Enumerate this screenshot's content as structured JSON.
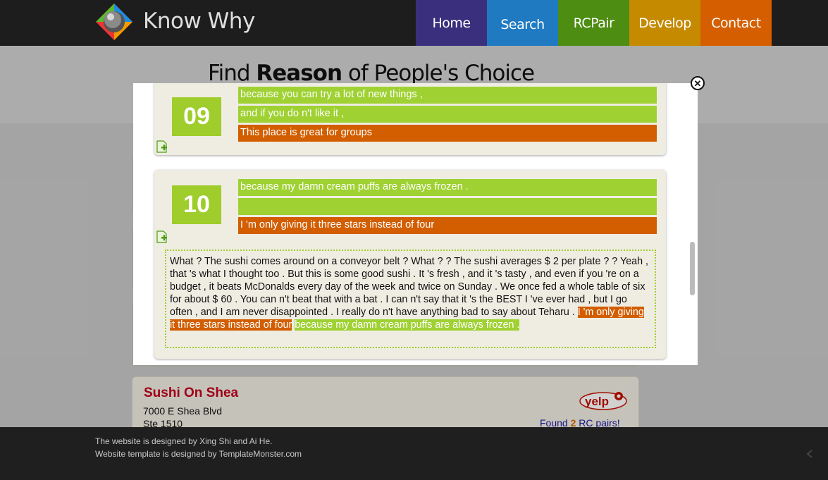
{
  "header": {
    "logo_text": "Know Why",
    "nav": [
      {
        "label": "Home",
        "color": "#3a2f7d"
      },
      {
        "label": "Search",
        "color": "#1f7ac2"
      },
      {
        "label": "RCPair",
        "color": "#4d8d12"
      },
      {
        "label": "Develop",
        "color": "#c58a00"
      },
      {
        "label": "Contact",
        "color": "#d55f00"
      }
    ],
    "active_nav": "Search"
  },
  "tagline": {
    "pre": "Find ",
    "bold": "Reason",
    "post": " of People's Choice"
  },
  "restaurant": {
    "name": "Sushi On Shea",
    "address_line1": "7000 E Shea Blvd",
    "address_line2": "Ste 1510",
    "badge_icon": "yelp-logo",
    "found_pre": "Found ",
    "found_count": "2",
    "found_post": " RC pairs!"
  },
  "modal": {
    "close_icon": "close-icon",
    "pairs": [
      {
        "number": "09",
        "bars": [
          {
            "text": "because you can try a lot of new things ,",
            "kind": "reason"
          },
          {
            "text": "and if you do n't like it ,",
            "kind": "reason"
          },
          {
            "text": "This place is great for groups",
            "kind": "choice"
          }
        ]
      },
      {
        "number": "10",
        "bars": [
          {
            "text": "because my damn cream puffs are always frozen .",
            "kind": "reason"
          },
          {
            "text": "",
            "kind": "reason"
          },
          {
            "text": "I 'm only giving it three stars instead of four",
            "kind": "choice"
          }
        ],
        "review": {
          "text": "What ? The sushi comes around on a conveyor belt ? What ? ? The sushi averages $ 2 per plate ? ? Yeah , that 's what I thought too . But this is some good sushi . It 's fresh , and it 's tasty , and even if you 're on a budget , it beats McDonalds every day of the week and twice on Sunday . We once fed a whole table of six for about $ 60 . You can n't beat that with a bat . I can n't say that it 's the BEST I 've ever had , but I go often , and I am never disappointed . I really do n't have anything bad to say about Teharu . ",
          "choice_highlight": "I 'm only giving it three stars instead of four",
          "reason_highlight": "because my damn cream puffs are always frozen ."
        }
      }
    ]
  },
  "footer": {
    "line1": "The website is designed by Xing Shi and Ai He.",
    "line2": "Website template is designed by TemplateMonster.com"
  },
  "colors": {
    "reason": "#9fd133",
    "choice": "#d25e00",
    "number_box": "#9fcd2b"
  }
}
